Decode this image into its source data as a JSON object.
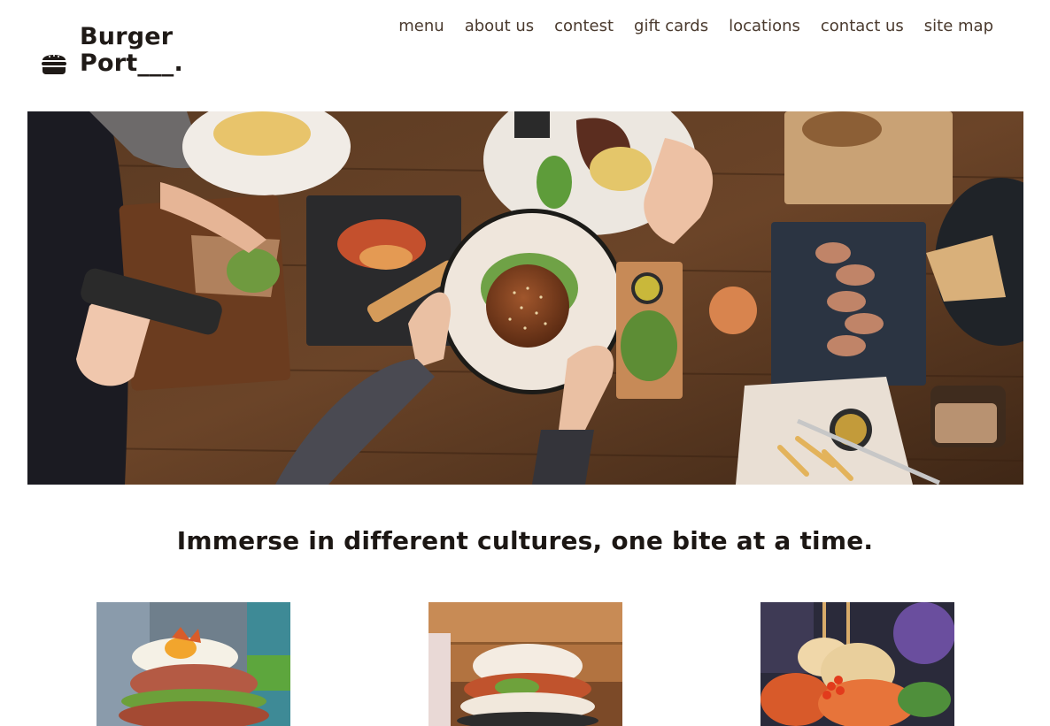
{
  "brand": {
    "line1": "Burger",
    "line2": "Port___.",
    "icon": "burger-icon"
  },
  "nav": {
    "items": [
      {
        "label": "menu"
      },
      {
        "label": "about us"
      },
      {
        "label": "contest"
      },
      {
        "label": "gift cards"
      },
      {
        "label": "locations"
      },
      {
        "label": "contact us"
      },
      {
        "label": "site map"
      }
    ]
  },
  "hero": {
    "image": "overhead-table-food-photo"
  },
  "tagline": "Immerse in different cultures, one bite at a time.",
  "features": [
    {
      "image": "egg-burger-photo"
    },
    {
      "image": "bao-bun-photo"
    },
    {
      "image": "skewer-appetizer-photo"
    }
  ],
  "colors": {
    "text": "#1f1a17",
    "nav": "#4a3a2e",
    "background": "#ffffff"
  }
}
